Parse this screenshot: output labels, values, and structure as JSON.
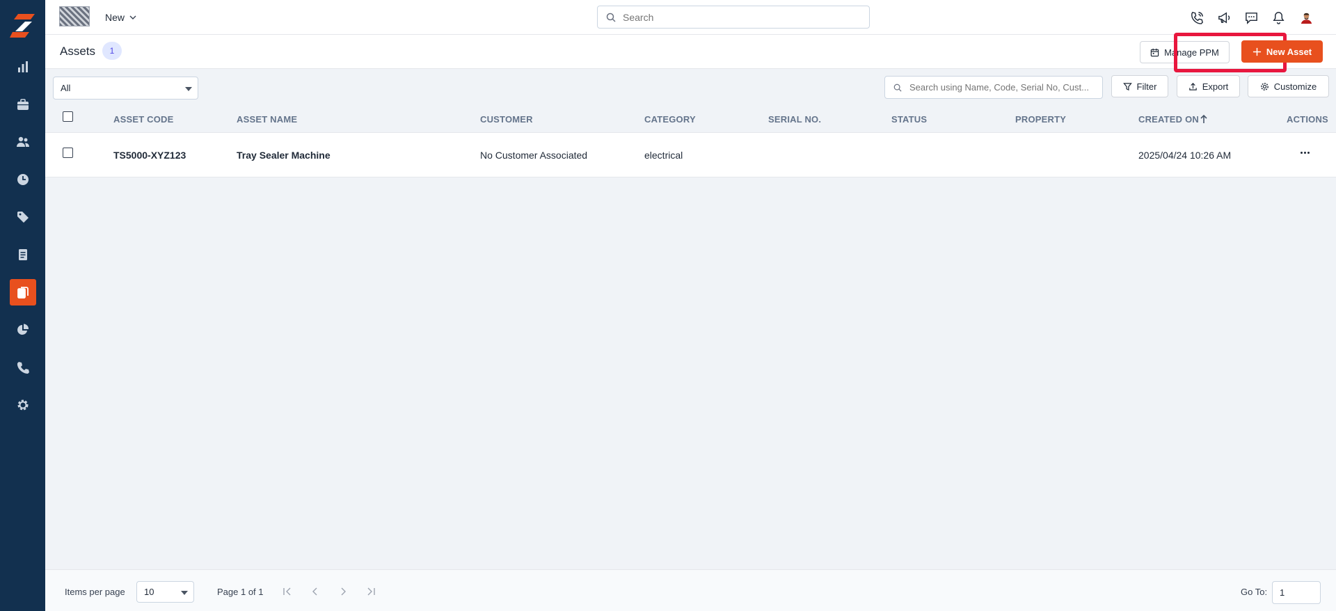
{
  "app": {
    "new_label": "New"
  },
  "search": {
    "placeholder": "Search"
  },
  "header": {
    "title": "Assets",
    "count": "1",
    "manage_ppm_label": "Manage PPM",
    "new_asset_label": "New Asset"
  },
  "toolbar": {
    "view_select": "All",
    "table_search_placeholder": "Search using Name, Code, Serial No, Cust...",
    "filter_label": "Filter",
    "export_label": "Export",
    "customize_label": "Customize"
  },
  "table": {
    "columns": [
      "ASSET CODE",
      "ASSET NAME",
      "CUSTOMER",
      "CATEGORY",
      "SERIAL NO.",
      "STATUS",
      "PROPERTY",
      "CREATED ON",
      "ACTIONS"
    ],
    "sort": {
      "column": "CREATED ON",
      "direction": "ascending"
    },
    "rows": [
      {
        "asset_code": "TS5000-XYZ123",
        "asset_name": "Tray Sealer Machine",
        "customer": "No Customer Associated",
        "category": "electrical",
        "serial_no": "",
        "status": "",
        "property": "",
        "created_on": "2025/04/24 10:26 AM"
      }
    ]
  },
  "footer": {
    "items_per_page_label": "Items per page",
    "items_per_page_value": "10",
    "page_info": "Page 1 of 1",
    "goto_label": "Go To:",
    "goto_value": "1"
  },
  "sidebar": {
    "items": [
      {
        "icon": "bar-chart-icon",
        "active": false
      },
      {
        "icon": "briefcase-icon",
        "active": false
      },
      {
        "icon": "users-icon",
        "active": false
      },
      {
        "icon": "clock-icon",
        "active": false
      },
      {
        "icon": "tag-icon",
        "active": false
      },
      {
        "icon": "document-icon",
        "active": false
      },
      {
        "icon": "copy-files-icon",
        "active": true
      },
      {
        "icon": "pie-chart-icon",
        "active": false
      },
      {
        "icon": "phone-icon",
        "active": false
      },
      {
        "icon": "gear-icon",
        "active": false
      }
    ]
  },
  "colors": {
    "sidebar": "#12304f",
    "accent": "#e8501e",
    "highlight": "#e8173e",
    "badge_bg": "#e0e7ff"
  }
}
